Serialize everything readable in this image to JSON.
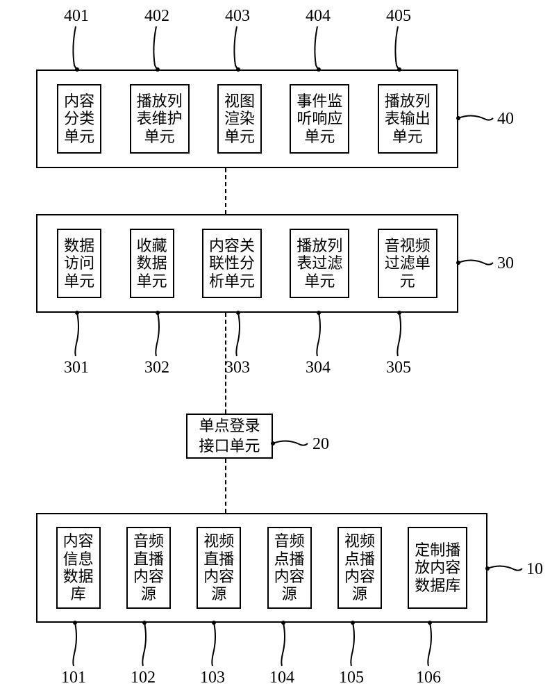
{
  "groups": {
    "g40": {
      "label": "40",
      "units": [
        {
          "id": "401",
          "text": "内容\n分类\n单元"
        },
        {
          "id": "402",
          "text": "播放列\n表维护\n单元"
        },
        {
          "id": "403",
          "text": "视图\n渲染\n单元"
        },
        {
          "id": "404",
          "text": "事件监\n听响应\n单元"
        },
        {
          "id": "405",
          "text": "播放列\n表输出\n单元"
        }
      ]
    },
    "g30": {
      "label": "30",
      "units": [
        {
          "id": "301",
          "text": "数据\n访问\n单元"
        },
        {
          "id": "302",
          "text": "收藏\n数据\n单元"
        },
        {
          "id": "303",
          "text": "内容关\n联性分\n析单元"
        },
        {
          "id": "304",
          "text": "播放列\n表过滤\n单元"
        },
        {
          "id": "305",
          "text": "音视频\n过滤单\n元"
        }
      ]
    },
    "g10": {
      "label": "10",
      "units": [
        {
          "id": "101",
          "text": "内容\n信息\n数据\n库"
        },
        {
          "id": "102",
          "text": "音频\n直播\n内容\n源"
        },
        {
          "id": "103",
          "text": "视频\n直播\n内容\n源"
        },
        {
          "id": "104",
          "text": "音频\n点播\n内容\n源"
        },
        {
          "id": "105",
          "text": "视频\n点播\n内容\n源"
        },
        {
          "id": "106",
          "text": "定制播\n放内容\n数据库"
        }
      ]
    }
  },
  "single": {
    "id": "20",
    "text": "单点登录\n接口单元"
  }
}
